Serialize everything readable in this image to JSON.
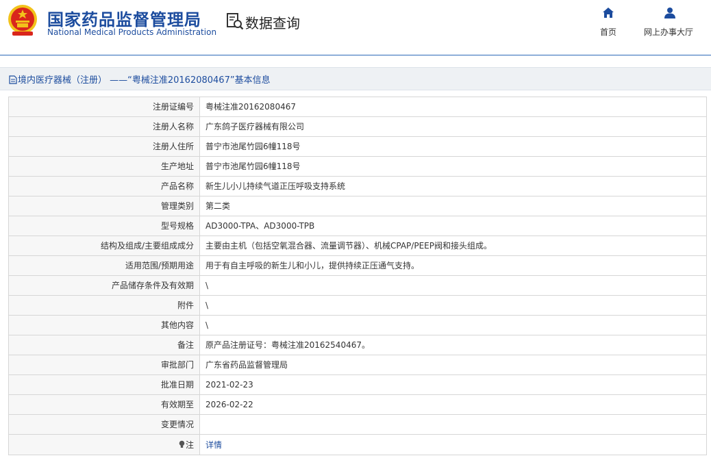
{
  "header": {
    "agency_name_cn": "国家药品监督管理局",
    "agency_name_en": "National Medical Products Administration",
    "section_title": "数据查询",
    "nav": [
      {
        "label": "首页",
        "icon": "home-icon"
      },
      {
        "label": "网上办事大厅",
        "icon": "user-icon"
      }
    ]
  },
  "breadcrumb": "境内医疗器械（注册） ——“粤械注准20162080467”基本信息",
  "details": [
    {
      "key": "注册证编号",
      "value": "粤械注准20162080467"
    },
    {
      "key": "注册人名称",
      "value": "广东鸽子医疗器械有限公司"
    },
    {
      "key": "注册人住所",
      "value": "普宁市池尾竹园6幢118号"
    },
    {
      "key": "生产地址",
      "value": "普宁市池尾竹园6幢118号"
    },
    {
      "key": "产品名称",
      "value": "新生儿小儿持续气道正压呼吸支持系统"
    },
    {
      "key": "管理类别",
      "value": "第二类"
    },
    {
      "key": "型号规格",
      "value": "AD3000-TPA、AD3000-TPB"
    },
    {
      "key": "结构及组成/主要组成成分",
      "value": "主要由主机（包括空氧混合器、流量调节器）、机械CPAP/PEEP阀和接头组成。"
    },
    {
      "key": "适用范围/预期用途",
      "value": "用于有自主呼吸的新生儿和小儿，提供持续正压通气支持。"
    },
    {
      "key": "产品储存条件及有效期",
      "value": "\\"
    },
    {
      "key": "附件",
      "value": "\\"
    },
    {
      "key": "其他内容",
      "value": "\\"
    },
    {
      "key": "备注",
      "value": "原产品注册证号：粤械注准20162540467。"
    },
    {
      "key": "审批部门",
      "value": "广东省药品监督管理局"
    },
    {
      "key": "批准日期",
      "value": "2021-02-23"
    },
    {
      "key": "有效期至",
      "value": "2026-02-22"
    },
    {
      "key": "变更情况",
      "value": ""
    }
  ],
  "note": {
    "key": "注",
    "link": "详情",
    "icon": "lightbulb-icon"
  },
  "colors": {
    "brand_blue": "#1c4c9e",
    "emblem_red": "#d9261c",
    "emblem_gold": "#f2c21b"
  }
}
